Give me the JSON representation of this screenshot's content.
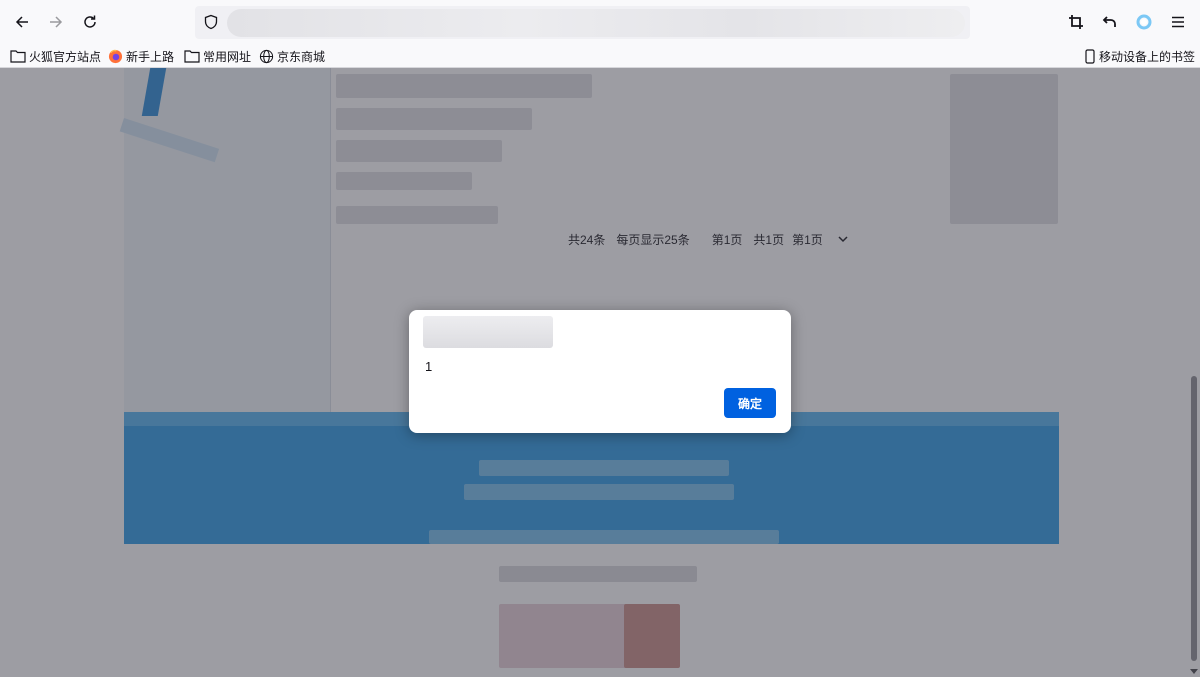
{
  "browser": {
    "url": "",
    "bookmarks": [
      {
        "icon": "folder-icon",
        "label": "火狐官方站点"
      },
      {
        "icon": "firefox-icon",
        "label": "新手上路"
      },
      {
        "icon": "folder-icon",
        "label": "常用网址"
      },
      {
        "icon": "globe-icon",
        "label": "京东商城"
      }
    ],
    "mobile_bookmarks": {
      "icon": "mobile-icon",
      "label": "移动设备上的书签"
    }
  },
  "page": {
    "pager": {
      "total": "共24条",
      "per_page": "每页显示25条",
      "current": "第1页",
      "pages": "共1页",
      "select_value": "第1页"
    }
  },
  "dialog": {
    "title": "",
    "message": "1",
    "ok_label": "确定"
  },
  "colors": {
    "accent": "#0061e0",
    "banner": "#2c9be4"
  }
}
